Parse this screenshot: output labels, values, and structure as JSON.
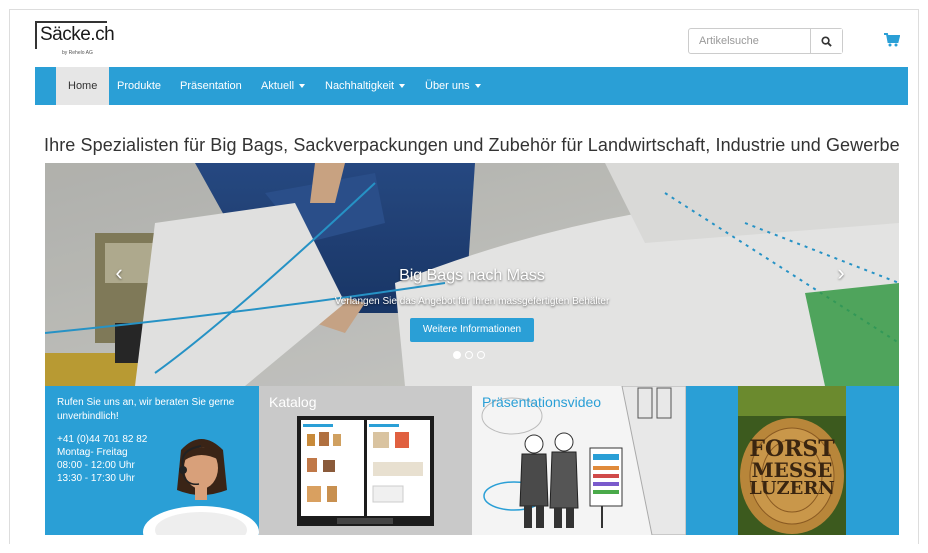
{
  "header": {
    "logo_text": "Säcke.ch",
    "logo_sub": "by Rehelo AG",
    "search_placeholder": "Artikelsuche"
  },
  "nav": {
    "items": [
      {
        "label": "Home",
        "active": true,
        "dropdown": false
      },
      {
        "label": "Produkte",
        "active": false,
        "dropdown": false
      },
      {
        "label": "Präsentation",
        "active": false,
        "dropdown": false
      },
      {
        "label": "Aktuell",
        "active": false,
        "dropdown": true
      },
      {
        "label": "Nachhaltigkeit",
        "active": false,
        "dropdown": true
      },
      {
        "label": "Über uns",
        "active": false,
        "dropdown": true
      }
    ]
  },
  "headline": "Ihre Spezialisten für Big Bags, Sackverpackungen und Zubehör für Landwirtschaft, Industrie und Gewerbe",
  "slider": {
    "title": "Big Bags nach Mass",
    "text": "Verlangen Sie das Angebot für Ihren massgefertigten Behälter",
    "button": "Weitere Informationen",
    "slides_total": 3,
    "active_slide": 1
  },
  "tiles": {
    "call": {
      "intro": "Rufen Sie uns an, wir beraten Sie gerne unverbindlich!",
      "phone": "+41 (0)44 701 82 82",
      "days": "Montag- Freitag",
      "hours1": "08:00 - 12:00 Uhr",
      "hours2": "13:30 - 17:30 Uhr"
    },
    "katalog": {
      "label": "Katalog"
    },
    "video": {
      "label": "Präsentationsvideo"
    },
    "forst": {
      "line1": "FORST",
      "line2": "MESSE",
      "line3": "LUZERN"
    }
  },
  "colors": {
    "accent": "#2a9fd6",
    "nav_active_bg": "#e6e6e6",
    "text": "#333333"
  }
}
